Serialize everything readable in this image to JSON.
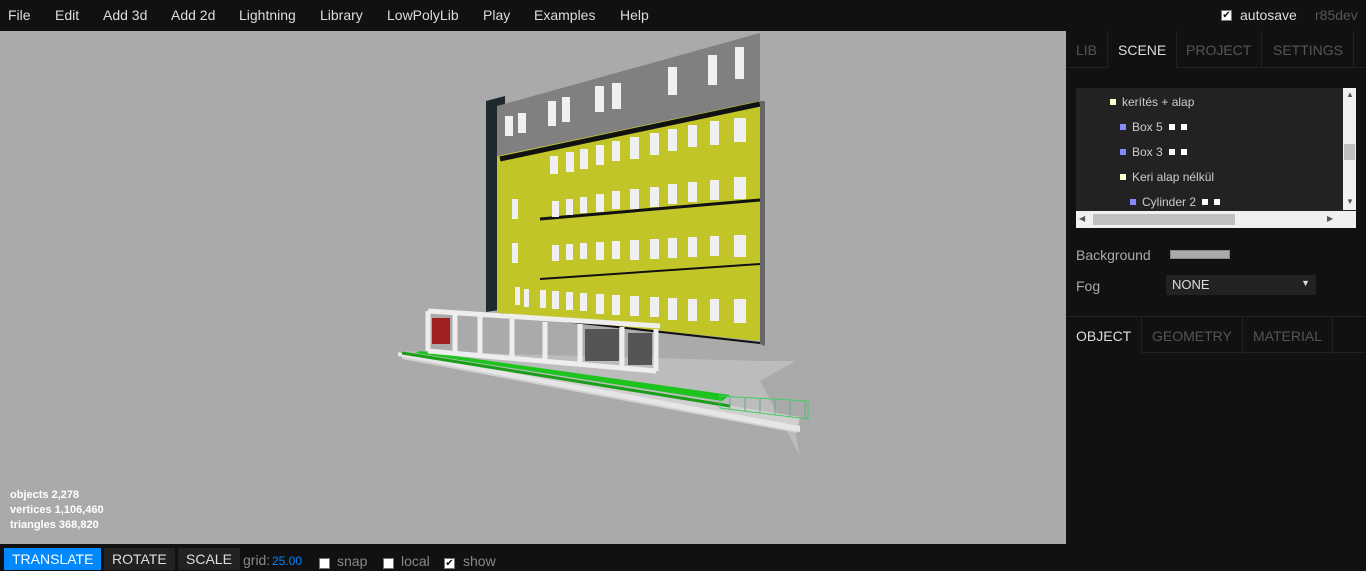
{
  "menubar": {
    "items": [
      "File",
      "Edit",
      "Add 3d",
      "Add 2d",
      "Lightning",
      "Library",
      "LowPolyLib",
      "Play",
      "Examples",
      "Help"
    ],
    "autosave_label": "autosave",
    "autosave_checked": true,
    "version": "r85dev"
  },
  "viewport": {
    "background": "#aaaaaa",
    "info": {
      "objects_label": "objects",
      "objects_value": "2,278",
      "vertices_label": "vertices",
      "vertices_value": "1,106,460",
      "triangles_label": "triangles",
      "triangles_value": "368,820"
    }
  },
  "toolbar": {
    "translate_label": "TRANSLATE",
    "rotate_label": "ROTATE",
    "scale_label": "SCALE",
    "grid_label": "grid:",
    "grid_value": "25.00",
    "snap_label": "snap",
    "snap_checked": false,
    "local_label": "local",
    "local_checked": false,
    "show_label": "show",
    "show_checked": true
  },
  "sidebar": {
    "tabs": [
      "LIB",
      "SCENE",
      "PROJECT",
      "SETTINGS"
    ],
    "active_tab": "SCENE",
    "outliner": [
      {
        "label": "kerítés + alap",
        "color": "#ffffcc",
        "extras": 0
      },
      {
        "label": "Box 5",
        "color": "#8888ff",
        "extras": 2
      },
      {
        "label": "Box 3",
        "color": "#8888ff",
        "extras": 2
      },
      {
        "label": "Keri alap nélkül",
        "color": "#ffffcc",
        "extras": 0
      },
      {
        "label": "Cylinder 2",
        "color": "#8888ff",
        "extras": 2
      }
    ],
    "background_label": "Background",
    "fog_label": "Fog",
    "fog_value": "NONE",
    "properties_tabs": [
      "OBJECT",
      "GEOMETRY",
      "MATERIAL"
    ],
    "active_properties_tab": "OBJECT"
  }
}
